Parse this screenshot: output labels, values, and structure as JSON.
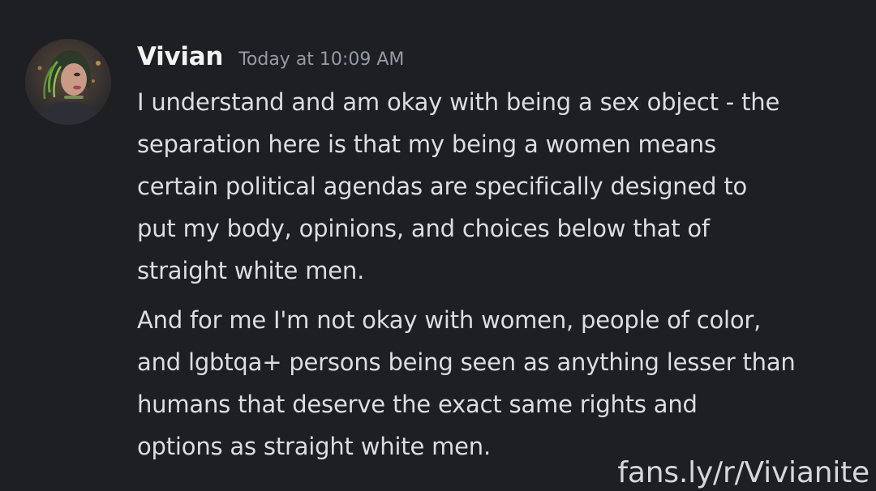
{
  "message": {
    "author": "Vivian",
    "timestamp": "Today at 10:09 AM",
    "paragraphs": [
      "I understand and am okay with being a sex object - the\nseparation here is that my being a women means\ncertain political agendas are specifically designed to\nput my body, opinions, and choices below that of\nstraight white men.",
      "And for me I'm not okay with women, people of color,\nand lgbtqa+ persons being seen as anything lesser than\nhumans that deserve the exact same rights and\noptions as straight white men."
    ]
  },
  "watermark": "fans.ly/r/Vivianite",
  "colors": {
    "background": "#1e1f22",
    "username": "#f2f3f5",
    "timestamp": "#949ba4",
    "text": "#dbdee1"
  }
}
